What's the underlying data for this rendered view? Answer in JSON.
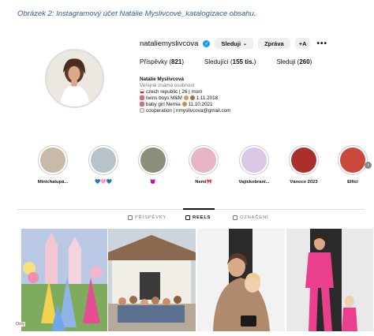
{
  "caption": "Obrázek 2: Instagramový účet Natálie Myslivcové_katalogizace obsahu.",
  "profile": {
    "username": "nataliemyslivcova",
    "verified_icon": "verified-badge-icon",
    "follow_label": "Sleduji",
    "message_label": "Zpráva",
    "add_user_label": "+A",
    "more_label": "•••",
    "colors": {
      "verified": "#1d9bf0",
      "button_bg": "#efefef",
      "caption": "#2e5d9a"
    }
  },
  "stats": {
    "posts_label": "Příspěvky",
    "posts_value": "821",
    "followers_label": "Sledující",
    "followers_value": "155 tis.",
    "following_label": "Sleduji",
    "following_value": "260"
  },
  "bio": {
    "name": "Natálie Myslivcová",
    "category": "Veřejně známá osobnost",
    "line1": "czech republic | 26 | mom",
    "line2": "twins boys M&M",
    "line2_date": "1.11.2018",
    "line3": "baby girl Nemia",
    "line3_date": "11.10.2021",
    "line4": "cooperation | nmyslivcova@gmail.com"
  },
  "highlights": [
    {
      "label": "Minichalupá...",
      "color": "#c9b9a8"
    },
    {
      "label": "💙🩷💙",
      "color": "#b7c3c9"
    },
    {
      "label": "😈",
      "color": "#8a8f7a"
    },
    {
      "label": "Nemi🎀",
      "color": "#e7b5c3"
    },
    {
      "label": "Vajíckobraní...",
      "color": "#d9c7e5"
    },
    {
      "label": "Vánoce 2023",
      "color": "#a9302d"
    },
    {
      "label": "Elfíci",
      "color": "#c94a3b"
    }
  ],
  "tabs": [
    {
      "label": "PŘÍSPĚVKY",
      "icon": "grid-icon",
      "active": false
    },
    {
      "label": "REELS",
      "icon": "reels-icon",
      "active": true
    },
    {
      "label": "OZNAČENÍ",
      "icon": "tagged-icon",
      "active": false
    }
  ],
  "posts": [
    {
      "name": "post-princess-party"
    },
    {
      "name": "post-kids-group"
    },
    {
      "name": "post-hug-child"
    },
    {
      "name": "post-pink-suit"
    }
  ],
  "overlay_badge": "Only"
}
